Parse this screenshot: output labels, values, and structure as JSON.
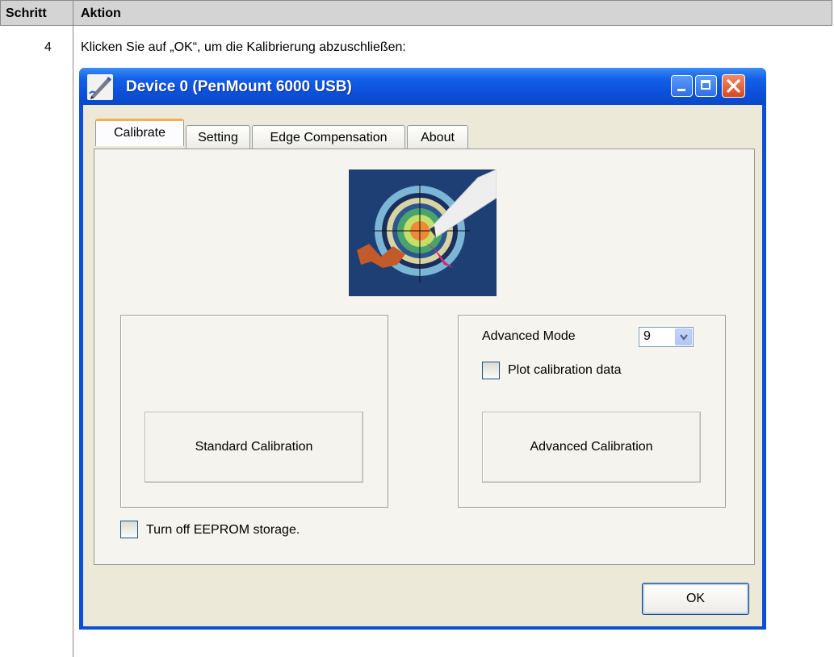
{
  "table": {
    "header_step": "Schritt",
    "header_action": "Aktion",
    "step_number": "4",
    "instruction": "Klicken Sie auf „OK“, um die Kalibrierung abzuschließen:"
  },
  "window": {
    "title": "Device 0 (PenMount 6000 USB)",
    "tabs": [
      {
        "label": "Calibrate",
        "active": true
      },
      {
        "label": "Setting",
        "active": false
      },
      {
        "label": "Edge Compensation",
        "active": false
      },
      {
        "label": "About",
        "active": false
      }
    ],
    "standard_button": "Standard Calibration",
    "advanced_mode_label": "Advanced Mode",
    "advanced_mode_value": "9",
    "plot_checkbox_label": "Plot calibration data",
    "plot_checked": false,
    "advanced_button": "Advanced Calibration",
    "eeprom_checkbox_label": "Turn off EEPROM storage.",
    "eeprom_checked": false,
    "ok_button": "OK"
  },
  "colors": {
    "titlebar": "#0c4fd8",
    "tab_highlight": "#f6b04a",
    "dialog_bg": "#ece9d8",
    "close_button": "#d7481e"
  }
}
